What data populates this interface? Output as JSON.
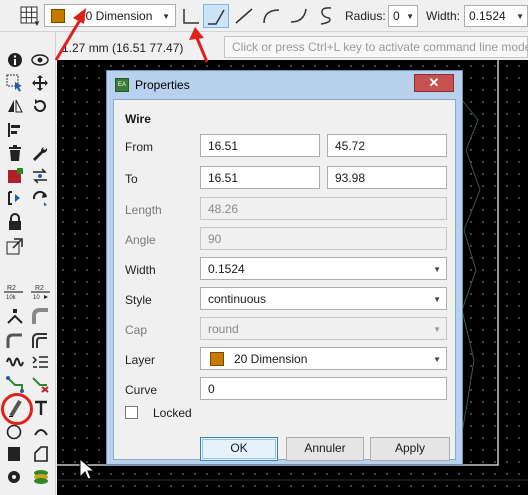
{
  "toolbar": {
    "layer_label": "20 Dimension",
    "layer_color": "#c87a00",
    "bend_modes": [
      "bend-right-angle-icon",
      "bend-45-icon",
      "bend-straight-icon",
      "bend-arc-icon",
      "bend-curve-icon",
      "bend-s-curve-icon"
    ],
    "radius_label": "Radius:",
    "radius_value": "0",
    "width_label": "Width:",
    "width_value": "0.1524"
  },
  "status": {
    "coordinates": "1.27 mm (16.51 77.47)",
    "command_placeholder": "Click or press Ctrl+L key to activate command line mode"
  },
  "tools": [
    "info-icon",
    "eye-icon",
    "select-icon",
    "move-icon",
    "mirror-icon",
    "rotate-icon",
    "align-icon",
    "delete-icon",
    "wrench-icon",
    "add-part-icon",
    "pinswap-icon",
    "replace-icon",
    "change-icon",
    "lock-icon",
    "resize-icon",
    "ratsnest-r2-icon",
    "ratsnest-r2-10-icon",
    "split-icon",
    "miter-icon",
    "meander-icon",
    "route-icon",
    "ripup-icon",
    "wire-icon",
    "text-icon",
    "circle-icon",
    "arc-icon",
    "rectangle-icon",
    "polygon-icon",
    "via-icon",
    "hole-icon"
  ],
  "dialog": {
    "title": "Properties",
    "close_glyph": "✕",
    "section": "Wire",
    "from_label": "From",
    "from_x": "16.51",
    "from_y": "45.72",
    "to_label": "To",
    "to_x": "16.51",
    "to_y": "93.98",
    "length_label": "Length",
    "length_value": "48.26",
    "angle_label": "Angle",
    "angle_value": "90",
    "width_label": "Width",
    "width_value": "0.1524",
    "style_label": "Style",
    "style_value": "continuous",
    "cap_label": "Cap",
    "cap_value": "round",
    "layer_label": "Layer",
    "layer_value": "20 Dimension",
    "curve_label": "Curve",
    "curve_value": "0",
    "locked_label": "Locked",
    "ok": "OK",
    "cancel": "Annuler",
    "apply": "Apply"
  },
  "annotation_color": "#e0201c"
}
